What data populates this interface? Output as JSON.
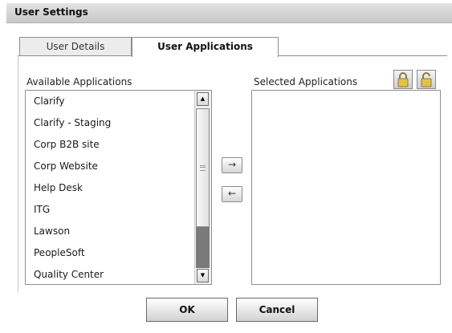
{
  "dialog": {
    "title": "User Settings"
  },
  "tabs": [
    {
      "label": "User Details",
      "active": false
    },
    {
      "label": "User Applications",
      "active": true
    }
  ],
  "available": {
    "label": "Available Applications",
    "items": [
      "Clarify",
      "Clarify - Staging",
      "Corp B2B site",
      "Corp Website",
      "Help Desk",
      "ITG",
      "Lawson",
      "PeopleSoft",
      "Quality Center"
    ]
  },
  "selected": {
    "label": "Selected Applications",
    "items": []
  },
  "icons": {
    "move_right": "arrow-right-icon",
    "move_left": "arrow-left-icon",
    "lock": "lock-icon",
    "unlock": "unlock-icon",
    "scroll_up": "triangle-up-icon",
    "scroll_down": "triangle-down-icon"
  },
  "buttons": {
    "ok": "OK",
    "cancel": "Cancel"
  }
}
